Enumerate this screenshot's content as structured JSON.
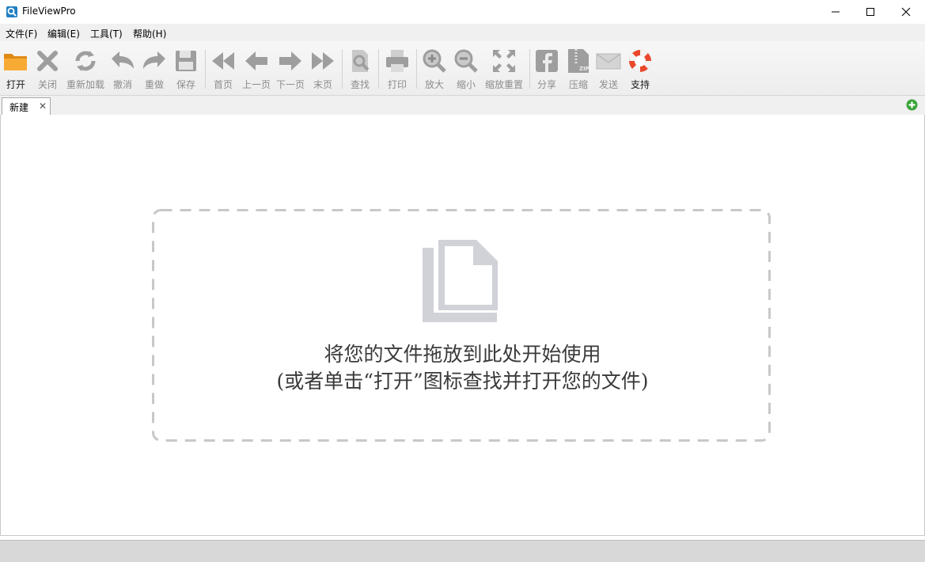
{
  "window": {
    "title": "FileViewPro"
  },
  "menu": {
    "items": [
      "文件(F)",
      "编辑(E)",
      "工具(T)",
      "帮助(H)"
    ]
  },
  "toolbar": {
    "open": "打开",
    "close": "关闭",
    "reload": "重新加载",
    "undo": "撤消",
    "redo": "重做",
    "save": "保存",
    "first": "首页",
    "prev": "上一页",
    "next": "下一页",
    "last": "末页",
    "find": "查找",
    "print": "打印",
    "zoom_in": "放大",
    "zoom_out": "缩小",
    "zoom_reset": "缩放重置",
    "share": "分享",
    "compress": "压缩",
    "send": "发送",
    "support": "支持"
  },
  "tabs": [
    {
      "label": "新建",
      "close": "✕"
    }
  ],
  "dropzone": {
    "line1": "将您的文件拖放到此处开始使用",
    "line2": "(或者单击“打开”图标查找并打开您的文件)"
  },
  "colors": {
    "accent_orange": "#f2a12e",
    "disabled_gray": "#9e9e9e",
    "add_green": "#3aa43a",
    "support_red": "#e8492c"
  }
}
